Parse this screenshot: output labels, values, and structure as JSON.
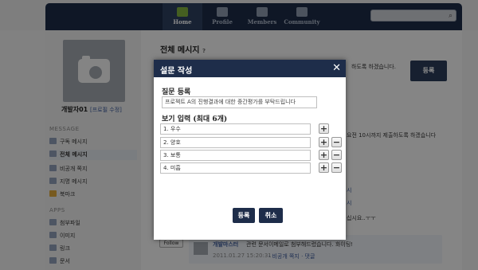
{
  "nav": {
    "items": [
      {
        "label": "Home",
        "icon": "home-icon"
      },
      {
        "label": "Profile",
        "icon": "profile-icon"
      },
      {
        "label": "Members",
        "icon": "members-icon"
      },
      {
        "label": "Community",
        "icon": "community-icon"
      }
    ]
  },
  "sidebar": {
    "profile_name": "개발자01",
    "profile_edit": "[프로필 수정]",
    "message_section": "MESSAGE",
    "message_items": [
      "구독 메시지",
      "전체 메시지",
      "비공개 쪽지",
      "지명 메시지",
      "북마크"
    ],
    "apps_section": "APPS",
    "app_items": [
      "첨부파일",
      "이미지",
      "링크",
      "문서"
    ]
  },
  "main": {
    "title": "전체 메시지",
    "help": "?",
    "snippet_top": "하도록 하겠습니다.",
    "submit_label": "등록",
    "snippet_mid": "요전 10시까지 제출하도록 하겠습니다",
    "snippet_link1": "시",
    "snippet_link2": "시",
    "snippet_text3": "십시요..ㅜㅜ",
    "follow_label": "Follow",
    "post_author": "개발마스터",
    "post_text": "관련 문서이메일로 첨부해드렸습니다. 화이팅!",
    "post_meta": "2011.01.27 15:20:31",
    "post_actions": "· 비공개 쪽지 · 댓글"
  },
  "modal": {
    "title": "설문 작성",
    "close": "✕",
    "question_label": "질문 등록",
    "question_value": "프로젝트 A의 진행결과에 대한 중간평가를 부탁드립니다",
    "options_label": "보기 입력 (최대 6개)",
    "options": [
      "1. 우수",
      "2. 양호",
      "3. 보통",
      "4. 미흡"
    ],
    "register_button": "등록",
    "cancel_button": "취소"
  }
}
